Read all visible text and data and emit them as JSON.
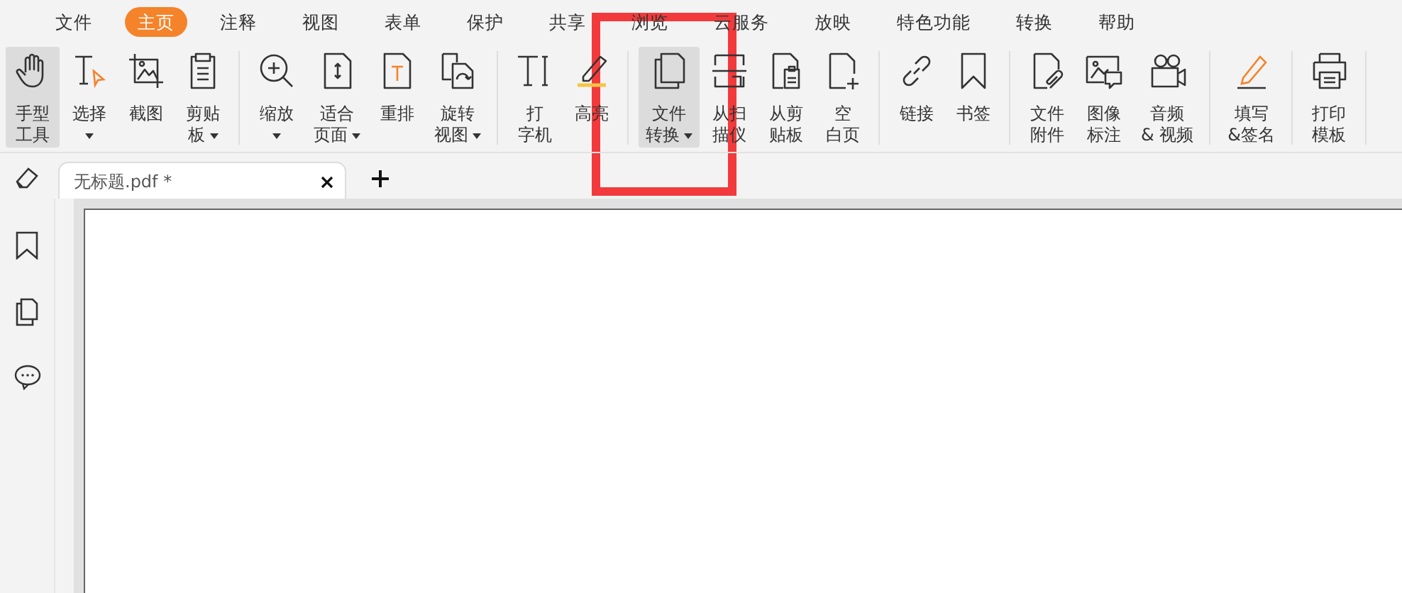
{
  "menu": [
    {
      "label": "文件",
      "selected": false
    },
    {
      "label": "主页",
      "selected": true
    },
    {
      "label": "注释",
      "selected": false
    },
    {
      "label": "视图",
      "selected": false
    },
    {
      "label": "表单",
      "selected": false
    },
    {
      "label": "保护",
      "selected": false
    },
    {
      "label": "共享",
      "selected": false
    },
    {
      "label": "浏览",
      "selected": false
    },
    {
      "label": "云服务",
      "selected": false
    },
    {
      "label": "放映",
      "selected": false
    },
    {
      "label": "特色功能",
      "selected": false
    },
    {
      "label": "转换",
      "selected": false
    },
    {
      "label": "帮助",
      "selected": false
    }
  ],
  "ribbon": [
    {
      "buttons": [
        {
          "lines": [
            "手型",
            "工具"
          ],
          "dropdown": false,
          "selected": true
        },
        {
          "lines": [
            "选择"
          ],
          "dropdown": true,
          "selected": false
        },
        {
          "lines": [
            "截图"
          ],
          "dropdown": false,
          "selected": false
        },
        {
          "lines": [
            "剪贴",
            "板"
          ],
          "dropdown": true,
          "selected": false
        }
      ]
    },
    {
      "buttons": [
        {
          "lines": [
            "缩放"
          ],
          "dropdown": true,
          "selected": false
        },
        {
          "lines": [
            "适合",
            "页面"
          ],
          "dropdown": true,
          "selected": false
        },
        {
          "lines": [
            "重排"
          ],
          "dropdown": false,
          "selected": false
        },
        {
          "lines": [
            "旋转",
            "视图"
          ],
          "dropdown": true,
          "selected": false
        }
      ]
    },
    {
      "buttons": [
        {
          "lines": [
            "打",
            "字机"
          ],
          "dropdown": false,
          "selected": false
        },
        {
          "lines": [
            "高亮"
          ],
          "dropdown": false,
          "selected": false
        }
      ]
    },
    {
      "buttons": [
        {
          "lines": [
            "文件",
            "转换"
          ],
          "dropdown": true,
          "selected": true
        },
        {
          "lines": [
            "从扫",
            "描仪"
          ],
          "dropdown": false,
          "selected": false
        },
        {
          "lines": [
            "从剪",
            "贴板"
          ],
          "dropdown": false,
          "selected": false
        },
        {
          "lines": [
            "空",
            "白页"
          ],
          "dropdown": false,
          "selected": false
        }
      ]
    },
    {
      "buttons": [
        {
          "lines": [
            "链接"
          ],
          "dropdown": false,
          "selected": false
        },
        {
          "lines": [
            "书签"
          ],
          "dropdown": false,
          "selected": false
        }
      ]
    },
    {
      "buttons": [
        {
          "lines": [
            "文件",
            "附件"
          ],
          "dropdown": false,
          "selected": false
        },
        {
          "lines": [
            "图像",
            "标注"
          ],
          "dropdown": false,
          "selected": false
        },
        {
          "lines": [
            "音频",
            "& 视频"
          ],
          "dropdown": false,
          "selected": false
        }
      ]
    },
    {
      "buttons": [
        {
          "lines": [
            "填写",
            "&签名"
          ],
          "dropdown": false,
          "selected": false
        }
      ]
    },
    {
      "buttons": [
        {
          "lines": [
            "打印",
            "模板"
          ],
          "dropdown": false,
          "selected": false
        }
      ]
    }
  ],
  "tabs": [
    {
      "title": "无标题.pdf *",
      "selected": true
    }
  ]
}
